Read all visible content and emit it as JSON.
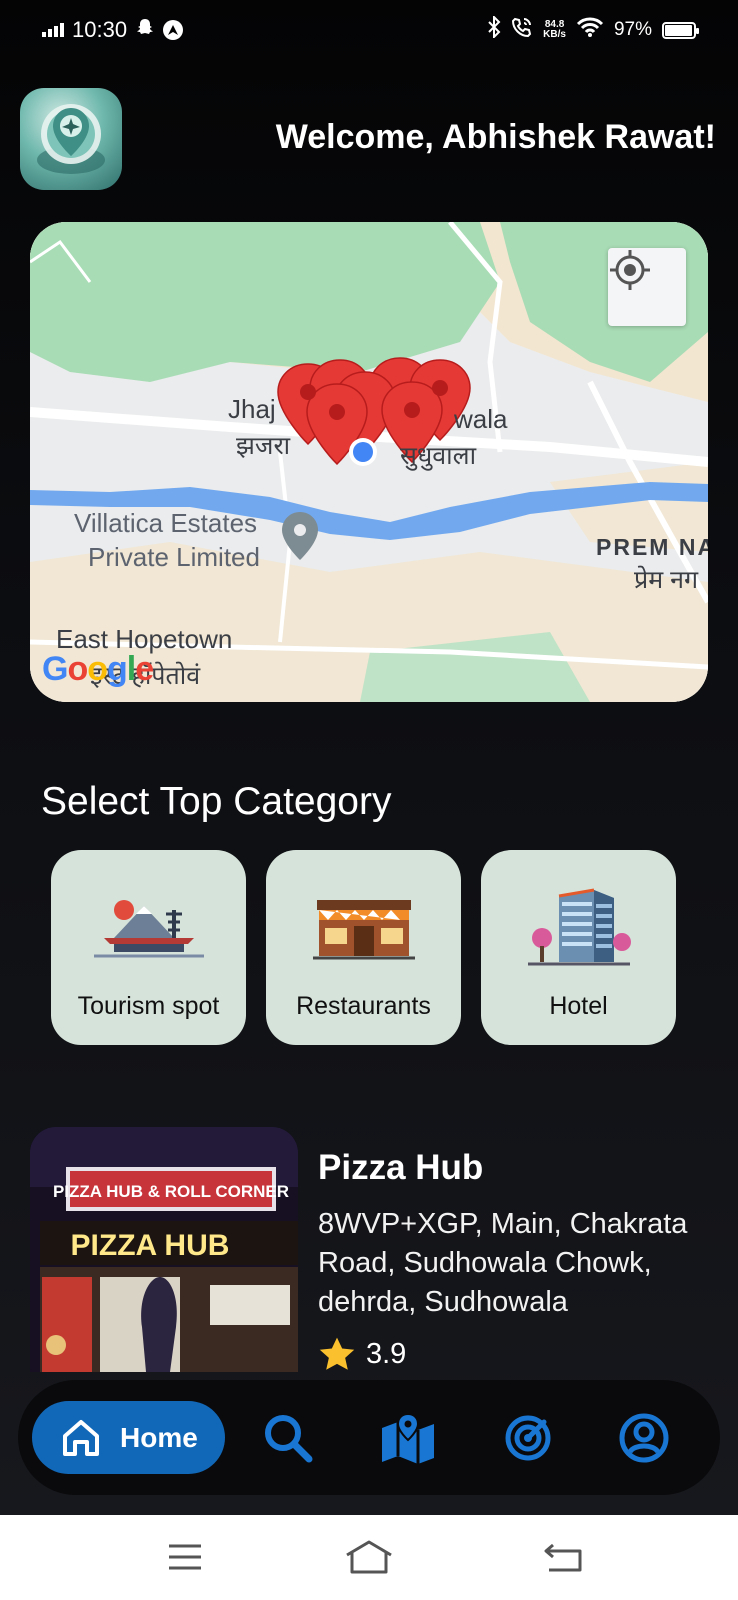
{
  "status_bar": {
    "time": "10:30",
    "net_speed_value": "84.8",
    "net_speed_unit": "KB/s",
    "battery": "97%",
    "battery_level": 0.97
  },
  "header": {
    "logo_icon": "airplane-location-icon",
    "welcome": "Welcome, Abhishek Rawat!"
  },
  "map": {
    "labels": {
      "jhajra_en": "Jhaj",
      "jhajra_hi": "झजरा",
      "sudhowala_en": "wala",
      "sudhowala_hi": "सुधुवाला",
      "villatica_1": "Villatica Estates",
      "villatica_2": "Private Limited",
      "prem_en": "PREM NA",
      "prem_hi": "प्रेम नग",
      "east_en": "East Hopetown",
      "east_hi": "इस्ट हॉपेतोवं"
    },
    "google": [
      "G",
      "o",
      "o",
      "g",
      "l",
      "e"
    ],
    "locate_icon": "my-location-icon",
    "colors": {
      "park": "#a8dcb5",
      "river": "#72a9ee",
      "land": "#ebeced",
      "marker": "#e53935",
      "user": "#4285f4"
    }
  },
  "categories": {
    "title": "Select Top Category",
    "items": [
      {
        "label": "Tourism spot",
        "icon": "pagoda-landscape-icon"
      },
      {
        "label": "Restaurants",
        "icon": "restaurant-storefront-icon"
      },
      {
        "label": "Hotel",
        "icon": "hotel-building-icon"
      }
    ]
  },
  "places": [
    {
      "name": "Pizza Hub",
      "address": "8WVP+XGP, Main, Chakrata Road, Sudhowala Chowk, dehrda, Sudhowala",
      "rating": "3.9",
      "sign_top": "PIZZA HUB & ROLL CORNER",
      "sign_main": "PIZZA HUB"
    }
  ],
  "bottom_nav": {
    "home_label": "Home",
    "items": [
      "home-icon",
      "search-icon",
      "map-icon",
      "radar-icon",
      "profile-icon"
    ],
    "accent": "#1268b8"
  },
  "system_nav": [
    "menu-icon",
    "home-icon",
    "back-icon"
  ]
}
